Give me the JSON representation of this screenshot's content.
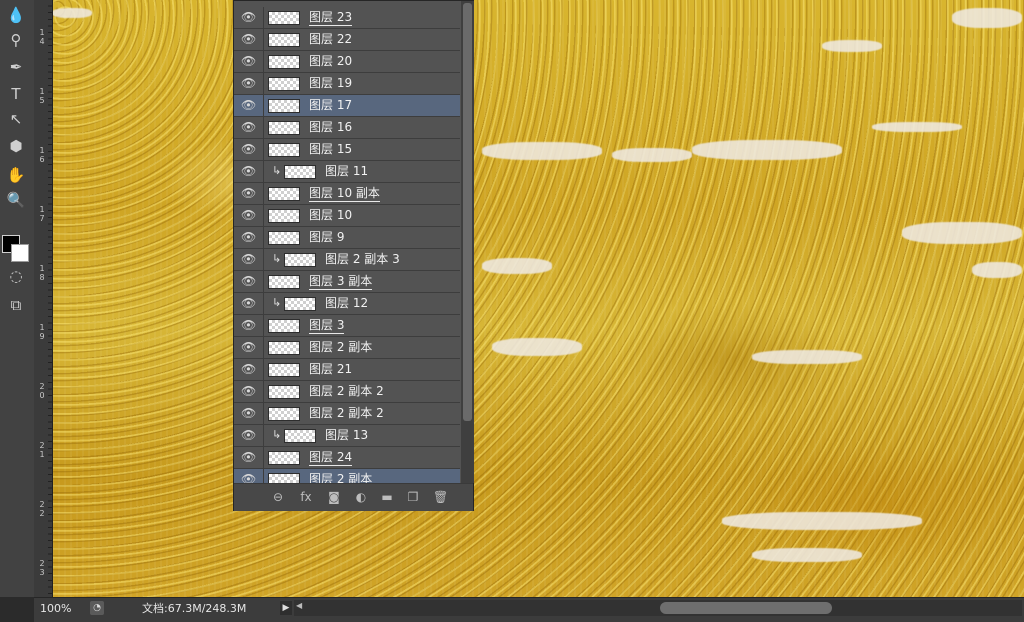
{
  "toolbox": {
    "tools": [
      {
        "name": "blur-tool-icon",
        "glyph": "💧"
      },
      {
        "name": "dodge-tool-icon",
        "glyph": "⚲"
      },
      {
        "name": "pen-tool-icon",
        "glyph": "✒"
      },
      {
        "name": "type-tool-icon",
        "glyph": "T"
      },
      {
        "name": "path-selection-tool-icon",
        "glyph": "↖"
      },
      {
        "name": "shape-tool-icon",
        "glyph": "⬢"
      },
      {
        "name": "hand-tool-icon",
        "glyph": "✋"
      },
      {
        "name": "zoom-tool-icon",
        "glyph": "🔍"
      },
      {
        "name": "quick-mask-icon",
        "glyph": "◌"
      },
      {
        "name": "screen-mode-icon",
        "glyph": "⧉"
      }
    ],
    "foreground_color": "#000000",
    "background_color": "#ffffff"
  },
  "ruler": {
    "labels": [
      "1\n4",
      "1\n5",
      "1\n6",
      "1\n7",
      "1\n8",
      "1\n9",
      "2\n0",
      "2\n1",
      "2\n2",
      "2\n3"
    ]
  },
  "layers_panel": {
    "layers": [
      {
        "name": "图层 23",
        "selected": false,
        "clipped": false,
        "underlined": true
      },
      {
        "name": "图层 22",
        "selected": false,
        "clipped": false,
        "underlined": false
      },
      {
        "name": "图层 20",
        "selected": false,
        "clipped": false,
        "underlined": false
      },
      {
        "name": "图层 19",
        "selected": false,
        "clipped": false,
        "underlined": false
      },
      {
        "name": "图层 17",
        "selected": true,
        "clipped": false,
        "underlined": false
      },
      {
        "name": "图层 16",
        "selected": false,
        "clipped": false,
        "underlined": false
      },
      {
        "name": "图层 15",
        "selected": false,
        "clipped": false,
        "underlined": false
      },
      {
        "name": "图层 11",
        "selected": false,
        "clipped": true,
        "underlined": false
      },
      {
        "name": "图层 10 副本",
        "selected": false,
        "clipped": false,
        "underlined": true
      },
      {
        "name": "图层 10",
        "selected": false,
        "clipped": false,
        "underlined": false
      },
      {
        "name": "图层 9",
        "selected": false,
        "clipped": false,
        "underlined": false
      },
      {
        "name": "图层 2 副本 3",
        "selected": false,
        "clipped": true,
        "underlined": false
      },
      {
        "name": "图层 3 副本",
        "selected": false,
        "clipped": false,
        "underlined": true
      },
      {
        "name": "图层 12",
        "selected": false,
        "clipped": true,
        "underlined": false
      },
      {
        "name": "图层 3",
        "selected": false,
        "clipped": false,
        "underlined": true
      },
      {
        "name": "图层 2 副本",
        "selected": false,
        "clipped": false,
        "underlined": false
      },
      {
        "name": "图层 21",
        "selected": false,
        "clipped": false,
        "underlined": false
      },
      {
        "name": "图层 2 副本 2",
        "selected": false,
        "clipped": false,
        "underlined": false
      },
      {
        "name": "图层 2 副本 2",
        "selected": false,
        "clipped": false,
        "underlined": false
      },
      {
        "name": "图层 13",
        "selected": false,
        "clipped": true,
        "underlined": false
      },
      {
        "name": "图层 24",
        "selected": false,
        "clipped": false,
        "underlined": true
      },
      {
        "name": "图层 2 副本",
        "selected": true,
        "clipped": false,
        "underlined": true
      }
    ],
    "footer_icons": [
      {
        "name": "link-layers-icon",
        "glyph": "⊖"
      },
      {
        "name": "fx-icon",
        "glyph": "fx"
      },
      {
        "name": "add-mask-icon",
        "glyph": "◙"
      },
      {
        "name": "adjustment-layer-icon",
        "glyph": "◐"
      },
      {
        "name": "new-group-icon",
        "glyph": "▬"
      },
      {
        "name": "new-layer-icon",
        "glyph": "❐"
      },
      {
        "name": "delete-layer-icon",
        "glyph": "🗑"
      }
    ]
  },
  "statusbar": {
    "zoom": "100%",
    "doc_info": "文档:67.3M/248.3M"
  },
  "icons": {
    "eye": "👁",
    "clip_arrow": "↳"
  }
}
